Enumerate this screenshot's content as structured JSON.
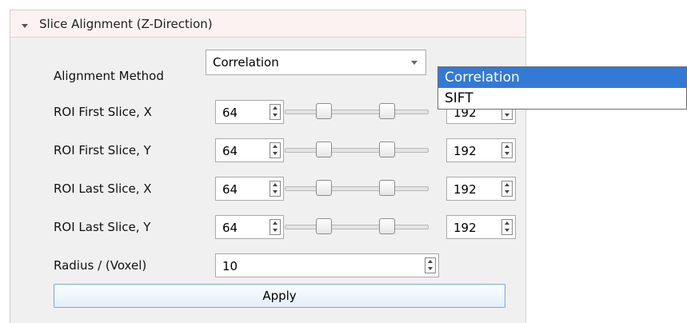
{
  "section": {
    "title": "Slice Alignment (Z-Direction)",
    "icon": "collapse-arrow-icon"
  },
  "alignment": {
    "label": "Alignment Method",
    "value": "Correlation"
  },
  "dropdown": {
    "options": [
      "Correlation",
      "SIFT"
    ],
    "selected": "Correlation"
  },
  "rows": [
    {
      "label": "ROI First Slice, X",
      "min": "64",
      "max": "192"
    },
    {
      "label": "ROI First Slice, Y",
      "min": "64",
      "max": "192"
    },
    {
      "label": "ROI Last Slice, X",
      "min": "64",
      "max": "192"
    },
    {
      "label": "ROI Last Slice, Y",
      "min": "64",
      "max": "192"
    }
  ],
  "radius": {
    "label": "Radius / (Voxel)",
    "value": "10"
  },
  "apply": {
    "label": "Apply"
  },
  "colors": {
    "highlight": "#3379d6",
    "header_bg": "#fdf2f2",
    "panel_bg": "#f0f0f0"
  }
}
